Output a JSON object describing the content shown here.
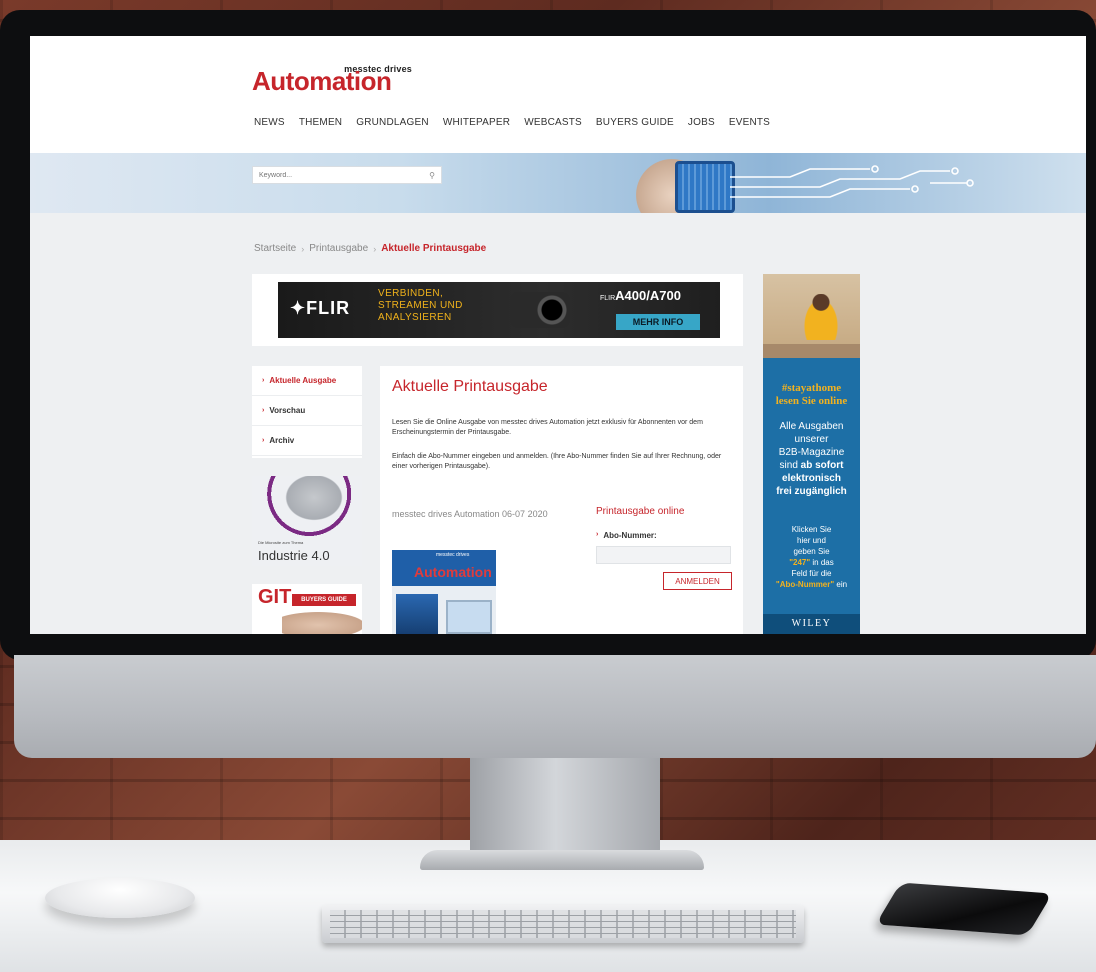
{
  "site": {
    "logo_small": "messtec drives",
    "logo_main": "Automation"
  },
  "nav": [
    "NEWS",
    "THEMEN",
    "GRUNDLAGEN",
    "WHITEPAPER",
    "WEBCASTS",
    "BUYERS GUIDE",
    "JOBS",
    "EVENTS"
  ],
  "search": {
    "placeholder": "Keyword..."
  },
  "breadcrumb": {
    "home": "Startseite",
    "section": "Printausgabe",
    "current": "Aktuelle Printausgabe"
  },
  "ad": {
    "brand": "FLIR",
    "tagline_1": "VERBINDEN,",
    "tagline_2": "STREAMEN UND",
    "tagline_3": "ANALYSIEREN",
    "model_prefix": "FLIR",
    "model": "A400/A700",
    "cta": "MEHR INFO"
  },
  "sidenav": [
    {
      "label": "Aktuelle Ausgabe",
      "active": true
    },
    {
      "label": "Vorschau",
      "active": false
    },
    {
      "label": "Archiv",
      "active": false
    }
  ],
  "promo1": {
    "small": "Die Microsite zum Thema",
    "big": "Industrie 4.0"
  },
  "promo2": {
    "brand": "GIT",
    "tag": "BUYERS GUIDE"
  },
  "content": {
    "title": "Aktuelle Printausgabe",
    "p1": "Lesen Sie die Online Ausgabe von messtec drives Automation jetzt exklusiv für Abonnenten vor dem Erscheinungstermin der Printausgabe.",
    "p2": "Einfach die Abo-Nummer eingeben und anmelden. (Ihre Abo-Nummer finden Sie auf Ihrer Rechnung, oder einer vorherigen Printausgabe).",
    "issue_title": "messtec drives Automation 06-07 2020",
    "cover_mini": "messtec drives",
    "cover_logo": "Automation",
    "online_title": "Printausgabe online",
    "abo_label": "Abo-Nummer:",
    "login": "ANMELDEN"
  },
  "sky": {
    "hash_1": "#stayathome",
    "hash_2": "lesen Sie online",
    "t1": "Alle Ausgaben",
    "t2": "unserer",
    "t3": "B2B-Magazine",
    "t4_pre": "sind ",
    "t4_bold": "ab sofort",
    "t5": "elektronisch",
    "t6": "frei zugänglich",
    "s1": "Klicken Sie",
    "s2": "hier und",
    "s3": "geben Sie",
    "s4_hl": "\"247\"",
    "s4_post": " in das",
    "s5": "Feld für die",
    "s6_hl": "\"Abo-Nummer\"",
    "s6_post": " ein",
    "wiley": "WILEY"
  },
  "colors": {
    "brand_red": "#c6252b",
    "sky_blue": "#1d6fa6",
    "accent_yellow": "#f2b21f"
  }
}
